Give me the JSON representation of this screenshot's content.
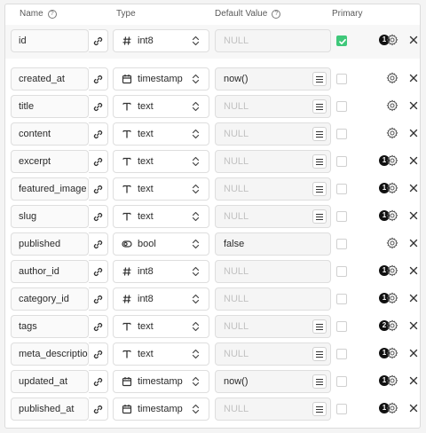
{
  "header": {
    "name": "Name",
    "type": "Type",
    "default_value": "Default Value",
    "primary": "Primary"
  },
  "colors": {
    "primary_checked": "#3fc87a",
    "badge": "#111111"
  },
  "columns": [
    {
      "name": "id",
      "type": "int8",
      "type_icon": "hash-icon",
      "default": "NULL",
      "default_is_null": true,
      "default_menu": false,
      "primary": true,
      "badge": "1",
      "removable": true
    },
    {
      "name": "created_at",
      "type": "timestamp",
      "type_icon": "calendar-icon",
      "default": "now()",
      "default_is_null": false,
      "default_menu": true,
      "primary": false,
      "badge": "",
      "removable": true
    },
    {
      "name": "title",
      "type": "text",
      "type_icon": "text-icon",
      "default": "NULL",
      "default_is_null": true,
      "default_menu": true,
      "primary": false,
      "badge": "",
      "removable": true
    },
    {
      "name": "content",
      "type": "text",
      "type_icon": "text-icon",
      "default": "NULL",
      "default_is_null": true,
      "default_menu": true,
      "primary": false,
      "badge": "",
      "removable": true
    },
    {
      "name": "excerpt",
      "type": "text",
      "type_icon": "text-icon",
      "default": "NULL",
      "default_is_null": true,
      "default_menu": true,
      "primary": false,
      "badge": "1",
      "removable": true
    },
    {
      "name": "featured_image",
      "type": "text",
      "type_icon": "text-icon",
      "default": "NULL",
      "default_is_null": true,
      "default_menu": true,
      "primary": false,
      "badge": "1",
      "removable": true
    },
    {
      "name": "slug",
      "type": "text",
      "type_icon": "text-icon",
      "default": "NULL",
      "default_is_null": true,
      "default_menu": true,
      "primary": false,
      "badge": "1",
      "removable": true
    },
    {
      "name": "published",
      "type": "bool",
      "type_icon": "toggle-icon",
      "default": "false",
      "default_is_null": false,
      "default_menu": false,
      "primary": false,
      "badge": "",
      "removable": true
    },
    {
      "name": "author_id",
      "type": "int8",
      "type_icon": "hash-icon",
      "default": "NULL",
      "default_is_null": true,
      "default_menu": false,
      "primary": false,
      "badge": "1",
      "removable": true
    },
    {
      "name": "category_id",
      "type": "int8",
      "type_icon": "hash-icon",
      "default": "NULL",
      "default_is_null": true,
      "default_menu": false,
      "primary": false,
      "badge": "1",
      "removable": true
    },
    {
      "name": "tags",
      "type": "text",
      "type_icon": "text-icon",
      "default": "NULL",
      "default_is_null": true,
      "default_menu": true,
      "primary": false,
      "badge": "2",
      "removable": true
    },
    {
      "name": "meta_description",
      "type": "text",
      "type_icon": "text-icon",
      "default": "NULL",
      "default_is_null": true,
      "default_menu": true,
      "primary": false,
      "badge": "1",
      "removable": true
    },
    {
      "name": "updated_at",
      "type": "timestamp",
      "type_icon": "calendar-icon",
      "default": "now()",
      "default_is_null": false,
      "default_menu": true,
      "primary": false,
      "badge": "1",
      "removable": true
    },
    {
      "name": "published_at",
      "type": "timestamp",
      "type_icon": "calendar-icon",
      "default": "NULL",
      "default_is_null": true,
      "default_menu": true,
      "primary": false,
      "badge": "1",
      "removable": true
    }
  ]
}
